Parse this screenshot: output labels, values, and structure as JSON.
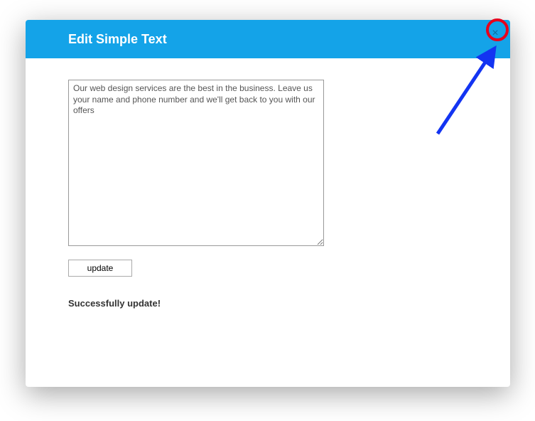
{
  "modal": {
    "title": "Edit Simple Text",
    "close_icon": "×",
    "textarea_value": "Our web design services are the best in the business. Leave us your name and phone number and we'll get back to you with our offers",
    "update_button_label": "update",
    "status_message": "Successfully update!"
  },
  "annotation": {
    "circle_color": "#e8001c",
    "arrow_color": "#1334f2"
  }
}
